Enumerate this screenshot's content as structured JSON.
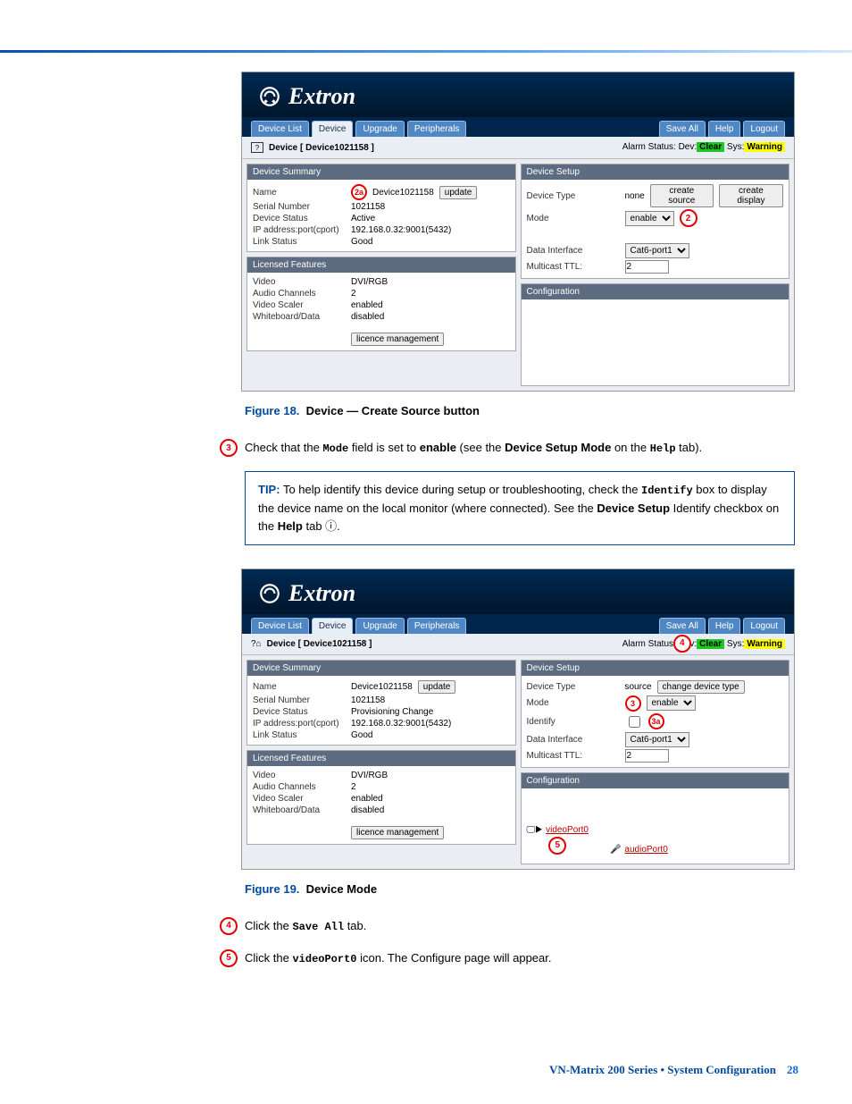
{
  "brand": "Extron",
  "nav": {
    "left": [
      "Device List",
      "Device",
      "Upgrade",
      "Peripherals"
    ],
    "active": "Device",
    "right": [
      "Save All",
      "Help",
      "Logout"
    ]
  },
  "alarm": {
    "prefix": "Alarm Status: Dev:",
    "dev": "Clear",
    "sep": " Sys:",
    "sys": "Warning"
  },
  "fig18": {
    "breadcrumb": "Device [ Device1021158 ]",
    "bcicon": "?",
    "summary": {
      "title": "Device Summary",
      "name_l": "Name",
      "name_v": "Device1021158",
      "update": "update",
      "serial_l": "Serial Number",
      "serial_v": "1021158",
      "status_l": "Device Status",
      "status_v": "Active",
      "ip_l": "IP address:port(cport)",
      "ip_v": "192.168.0.32:9001(5432)",
      "link_l": "Link Status",
      "link_v": "Good"
    },
    "setup": {
      "title": "Device Setup",
      "type_l": "Device Type",
      "type_v": "none",
      "btn1": "create source",
      "btn2": "create display",
      "mode_l": "Mode",
      "mode_sel": "enable",
      "di_l": "Data Interface",
      "di_sel": "Cat6-port1",
      "ttl_l": "Multicast TTL:",
      "ttl_v": "2"
    },
    "lic": {
      "title": "Licensed Features",
      "video_l": "Video",
      "video_v": "DVI/RGB",
      "audio_l": "Audio Channels",
      "audio_v": "2",
      "scaler_l": "Video Scaler",
      "scaler_v": "enabled",
      "wb_l": "Whiteboard/Data",
      "wb_v": "disabled",
      "btn": "licence management"
    },
    "config_title": "Configuration",
    "caption_b": "Figure 18.",
    "caption_t": "Device — Create Source button"
  },
  "step3": {
    "num": "3",
    "t1": "Check that the ",
    "t2": "Mode",
    "t3": " field is set to ",
    "t4": "enable",
    "t5": " (see the ",
    "t6": "Device Setup Mode",
    "t7": " on the ",
    "t8": "Help",
    "t9": " tab)."
  },
  "tip": {
    "label": "TIP:",
    "l1a": "To help identify this device during setup or troubleshooting, check the ",
    "l1b": "Identify",
    "l1c": " box to display the device name on the local monitor (where connected). See the ",
    "l1d": "Device Setup",
    "l1e": " Identify checkbox on the ",
    "l1f": "Help",
    "l1g": " tab ",
    "l1h": "."
  },
  "fig19": {
    "breadcrumb": "Device [ Device1021158 ]",
    "summary": {
      "name_v": "Device1021158",
      "serial_v": "1021158",
      "status_v": "Provisioning Change",
      "ip_v": "192.168.0.32:9001(5432)",
      "link_v": "Good"
    },
    "setup": {
      "type_l": "Device Type",
      "type_v": "source",
      "btn": "change device type",
      "mode_l": "Mode",
      "mode_sel": "enable",
      "id_l": "Identify",
      "di_l": "Data Interface",
      "di_sel": "Cat6-port1",
      "ttl_l": "Multicast TTL:",
      "ttl_v": "2"
    },
    "conf": {
      "link1": "videoPort0",
      "link2": "audioPort0"
    },
    "caption_b": "Figure 19.",
    "caption_t": "Device Mode"
  },
  "step4": {
    "num": "4",
    "t1": "Click the ",
    "t2": "Save All",
    "t3": " tab."
  },
  "step5": {
    "num": "5",
    "t1": "Click the ",
    "t2": "videoPort0",
    "t3": " icon. The Configure page will appear."
  },
  "footer": {
    "text": "VN-Matrix 200 Series • System Configuration",
    "page": "28"
  }
}
